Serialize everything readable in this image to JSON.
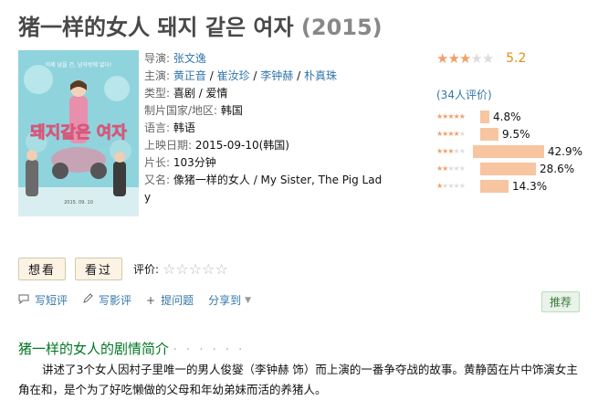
{
  "title": {
    "main": "猪一样的女人 돼지 같은 여자",
    "year": "(2015)"
  },
  "poster": {
    "tagline": "이제 남을 건, 남자밖에 없다!",
    "title_text": "돼지같은 여자",
    "date_text": "2015. 09. 10"
  },
  "info": {
    "director_label": "导演:",
    "director": "张文逸",
    "cast_label": "主演:",
    "cast": [
      "黄正音",
      "崔汝珍",
      "李钟赫",
      "朴真珠"
    ],
    "genre_label": "类型:",
    "genre": "喜剧 / 爱情",
    "country_label": "制片国家/地区:",
    "country": "韩国",
    "language_label": "语言:",
    "language": "韩语",
    "release_label": "上映日期:",
    "release": "2015-09-10(韩国)",
    "runtime_label": "片长:",
    "runtime": "103分钟",
    "aka_label": "又名:",
    "aka": "像猪一样的女人 / My Sister, The Pig Lady"
  },
  "rating": {
    "score": "5.2",
    "stars_filled": 3,
    "votes_text": "(34人评价)",
    "distribution": [
      {
        "stars": 5,
        "percent": 4.8,
        "label": "4.8%"
      },
      {
        "stars": 4,
        "percent": 9.5,
        "label": "9.5%"
      },
      {
        "stars": 3,
        "percent": 42.9,
        "label": "42.9%"
      },
      {
        "stars": 2,
        "percent": 28.6,
        "label": "28.6%"
      },
      {
        "stars": 1,
        "percent": 14.3,
        "label": "14.3%"
      }
    ]
  },
  "actions": {
    "want": "想看",
    "seen": "看过",
    "rate_label": "评价:"
  },
  "links": {
    "short_review": "写短评",
    "review": "写影评",
    "ask": "提问题",
    "share": "分享到",
    "recommend": "推荐"
  },
  "synopsis": {
    "title": "猪一样的女人的剧情简介",
    "dots": "· · · · · ·",
    "text": "讲述了3个女人因村子里唯一的男人俊燮（李钟赫 饰）而上演的一番争夺战的故事。黄静茵在片中饰演女主角在和，是个为了好吃懒做的父母和年幼弟妹而活的养猪人。"
  },
  "colors": {
    "link": "#3377aa",
    "star": "#f0a06b",
    "bar": "#f7c5a0",
    "section": "#007722",
    "score": "#e09015"
  }
}
